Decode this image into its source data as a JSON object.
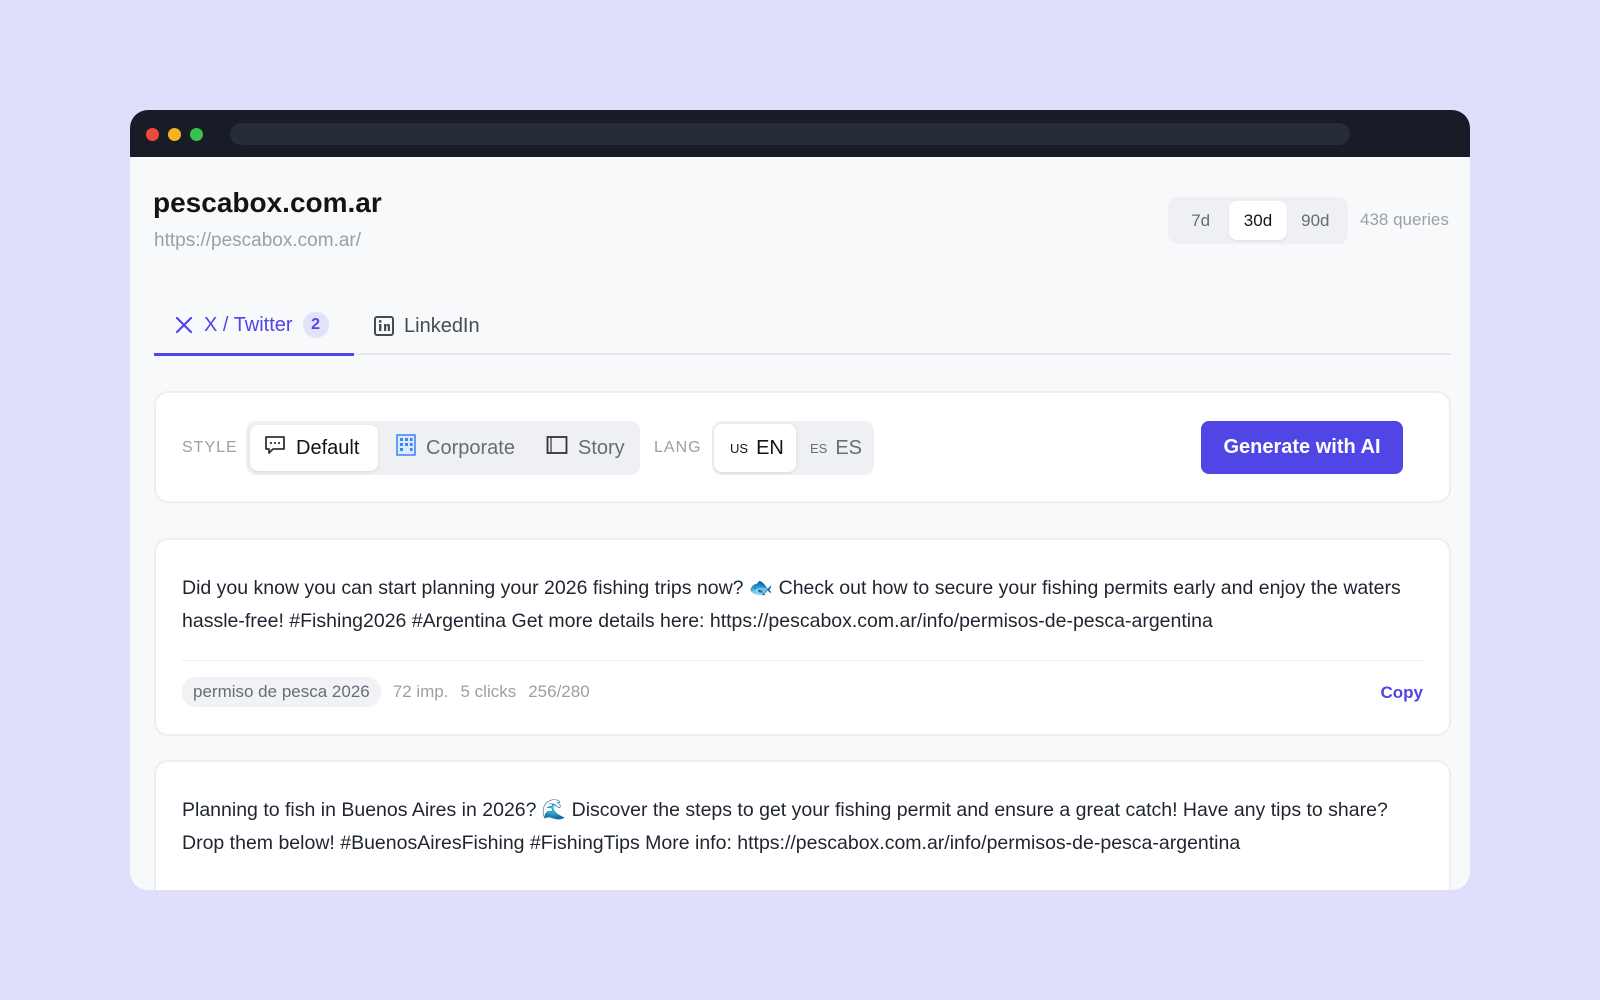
{
  "site": {
    "title": "pescabox.com.ar",
    "url": "https://pescabox.com.ar/"
  },
  "range": {
    "options": [
      "7d",
      "30d",
      "90d"
    ],
    "selected": "30d",
    "queries": "438 queries"
  },
  "tabs": [
    {
      "label": "X / Twitter",
      "badge": "2",
      "icon": "x-logo-icon",
      "active": true
    },
    {
      "label": "LinkedIn",
      "icon": "linkedin-icon",
      "active": false
    }
  ],
  "controls": {
    "style_label": "STYLE",
    "styles": [
      {
        "label": "Default",
        "icon": "chat-bubble-icon",
        "active": true
      },
      {
        "label": "Corporate",
        "icon": "building-icon",
        "active": false
      },
      {
        "label": "Story",
        "icon": "book-icon",
        "active": false
      }
    ],
    "lang_label": "LANG",
    "langs": [
      {
        "code": "US",
        "label": "EN",
        "active": true
      },
      {
        "code": "ES",
        "label": "ES",
        "active": false
      }
    ],
    "generate_label": "Generate with AI"
  },
  "posts": [
    {
      "text": "Did you know you can start planning your 2026 fishing trips now? 🐟 Check out how to secure your fishing permits early and enjoy the waters hassle-free! #Fishing2026 #Argentina Get more details here: https://pescabox.com.ar/info/permisos-de-pesca-argentina",
      "keyword": "permiso de pesca 2026",
      "impressions": "72 imp.",
      "clicks": "5 clicks",
      "chars": "256/280",
      "copy_label": "Copy"
    },
    {
      "text": "Planning to fish in Buenos Aires in 2026? 🌊 Discover the steps to get your fishing permit and ensure a great catch! Have any tips to share? Drop them below! #BuenosAiresFishing #FishingTips More info: https://pescabox.com.ar/info/permisos-de-pesca-argentina"
    }
  ],
  "colors": {
    "accent": "#4f46e5",
    "background": "#dfdffb",
    "titlebar": "#181c27"
  }
}
